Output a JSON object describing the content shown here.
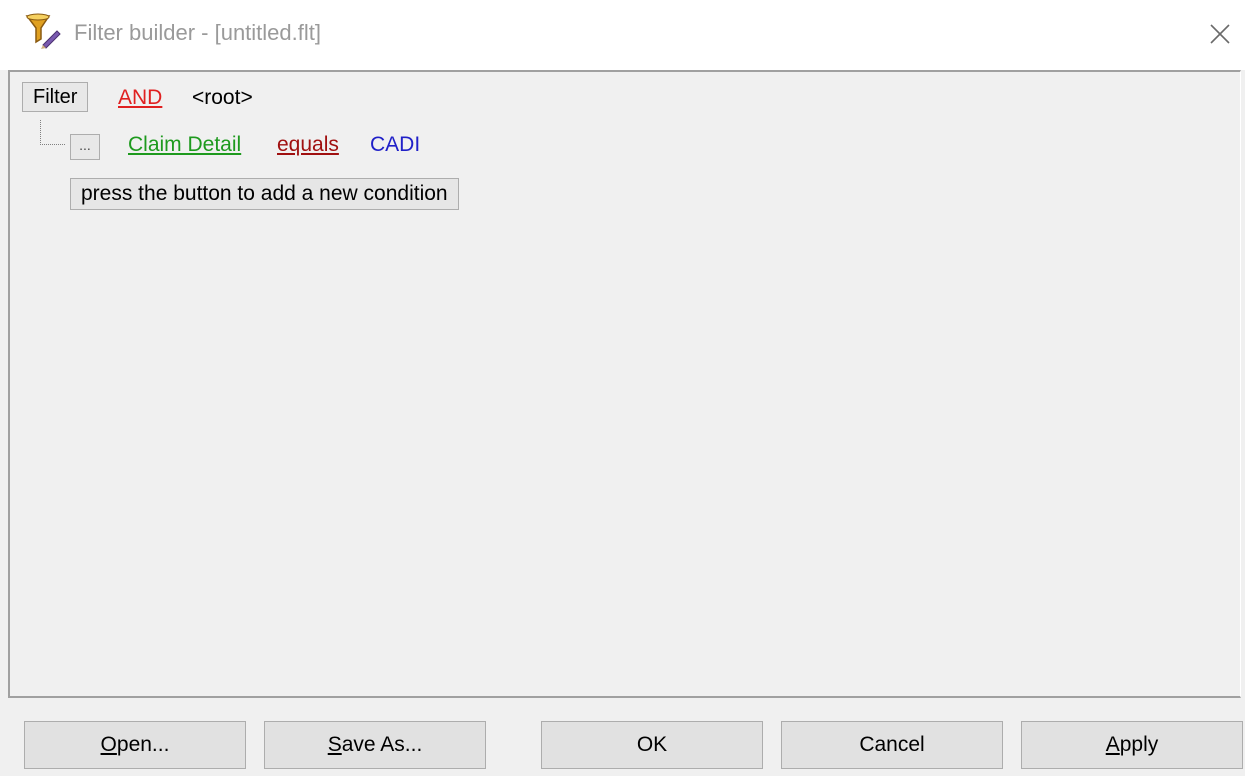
{
  "window": {
    "title": "Filter builder - [untitled.flt]",
    "icon": "filter-funnel-icon",
    "close_icon": "close-icon"
  },
  "tree": {
    "root_button": "Filter",
    "root_operator": "AND",
    "root_label": "<root>",
    "conditions": [
      {
        "button": "...",
        "field": "Claim Detail",
        "operator": "equals",
        "value": "CADI"
      }
    ],
    "add_condition_label": "press the button to add a new condition"
  },
  "buttons": {
    "open": {
      "accel": "O",
      "rest": "pen..."
    },
    "save_as": {
      "accel": "S",
      "rest": "ave As..."
    },
    "ok": "OK",
    "cancel": "Cancel",
    "apply": {
      "accel": "A",
      "rest": "pply"
    }
  },
  "colors": {
    "operator_and": "#e02020",
    "field": "#1e9a1e",
    "condition_operator": "#a01010",
    "value": "#2020c8"
  }
}
